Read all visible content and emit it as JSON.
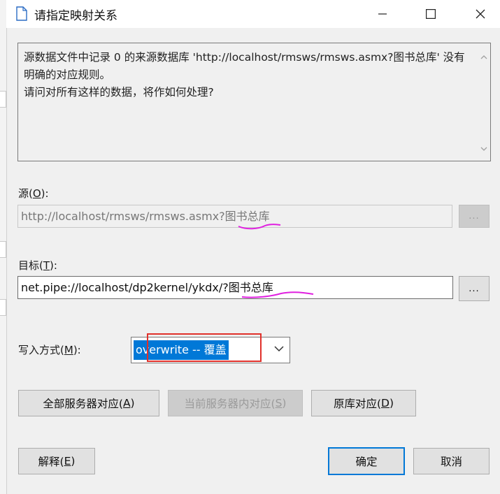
{
  "window": {
    "title": "请指定映射关系",
    "icon": "document-icon",
    "buttons": [
      "minimize-icon",
      "maximize-icon",
      "close-icon"
    ]
  },
  "message": {
    "text": "源数据文件中记录 0 的来源数据库 'http://localhost/rmsws/rmsws.asmx?图书总库' 没有明确的对应规则。\n请问对所有这样的数据，将作如何处理?"
  },
  "source": {
    "label": "源(",
    "label_key": "O",
    "label_end": "):",
    "value": "http://localhost/rmsws/rmsws.asmx?图书总库",
    "browse_label": "..."
  },
  "target": {
    "label": "目标(",
    "label_key": "T",
    "label_end": "):",
    "value": "net.pipe://localhost/dp2kernel/ykdx/?图书总库",
    "browse_label": "..."
  },
  "write_mode": {
    "label": "写入方式(",
    "label_key": "M",
    "label_end": "):",
    "selected": "overwrite -- 覆盖"
  },
  "actions": {
    "all_servers": {
      "label": "全部服务器对应(",
      "key": "A",
      "end": ")"
    },
    "current_server": {
      "label": "当前服务器内对应(",
      "key": "S",
      "end": ")"
    },
    "original_db": {
      "label": "原库对应(",
      "key": "D",
      "end": ")"
    }
  },
  "footer": {
    "explain": {
      "label": "解释(",
      "key": "E",
      "end": ")"
    },
    "ok": "确定",
    "cancel": "取消"
  },
  "colors": {
    "accent": "#0078d7",
    "annotation_red": "#e0302a",
    "annotation_magenta": "#e020e0"
  }
}
